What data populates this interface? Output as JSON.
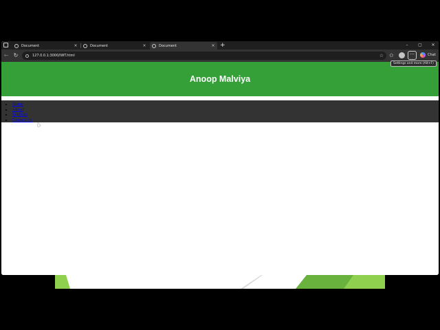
{
  "browser": {
    "tabs": [
      {
        "title": "Document",
        "active": false
      },
      {
        "title": "Document",
        "active": false
      },
      {
        "title": "Document",
        "active": true
      }
    ],
    "new_tab_glyph": "+",
    "url": "127.0.0.1:3000/IWT.html",
    "more_glyph": "···",
    "tooltip": "Settings and more (Alt+F)",
    "chat_label": "Chat",
    "window_controls": {
      "minimize": "–",
      "restore": "▢",
      "close": "✕"
    }
  },
  "page": {
    "header_title": "Anoop Malviya",
    "nav_links": [
      "Home",
      "About",
      "Services",
      "Contact Us"
    ]
  },
  "colors": {
    "header_green": "#34a037",
    "nav_bg": "#333333",
    "slide_green_light": "#8fd14f",
    "slide_green": "#6ab23e"
  }
}
